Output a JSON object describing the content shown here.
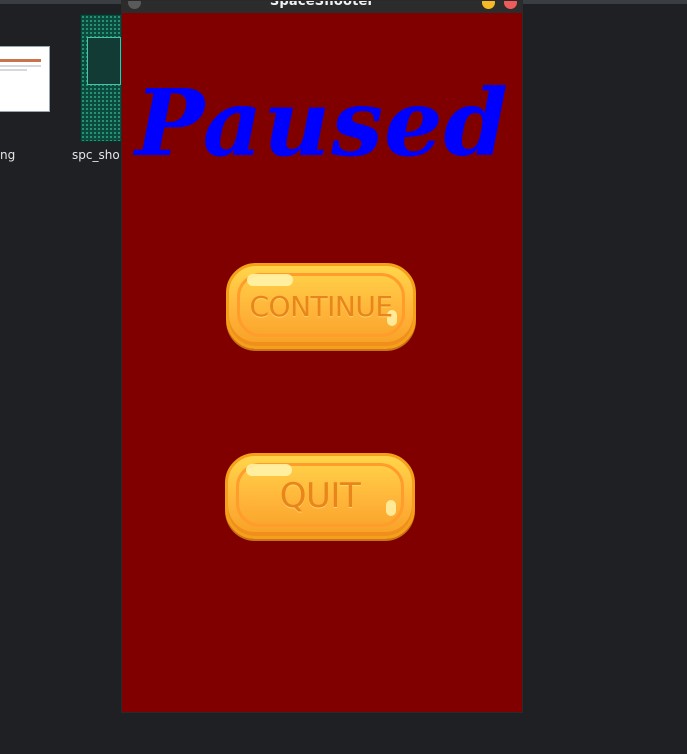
{
  "window": {
    "title": "SpaceShooter"
  },
  "desktop": {
    "files": [
      {
        "label": "ng"
      },
      {
        "label": "spc_sho"
      }
    ]
  },
  "pause_menu": {
    "title": "Paused",
    "continue_label": "CONTINUE",
    "quit_label": "QUIT"
  },
  "colors": {
    "window_background": "#800000",
    "title_color": "#0000ff",
    "button_fill": "#ffb53a",
    "button_text": "#e8861b",
    "desktop_background": "#1e2023"
  }
}
